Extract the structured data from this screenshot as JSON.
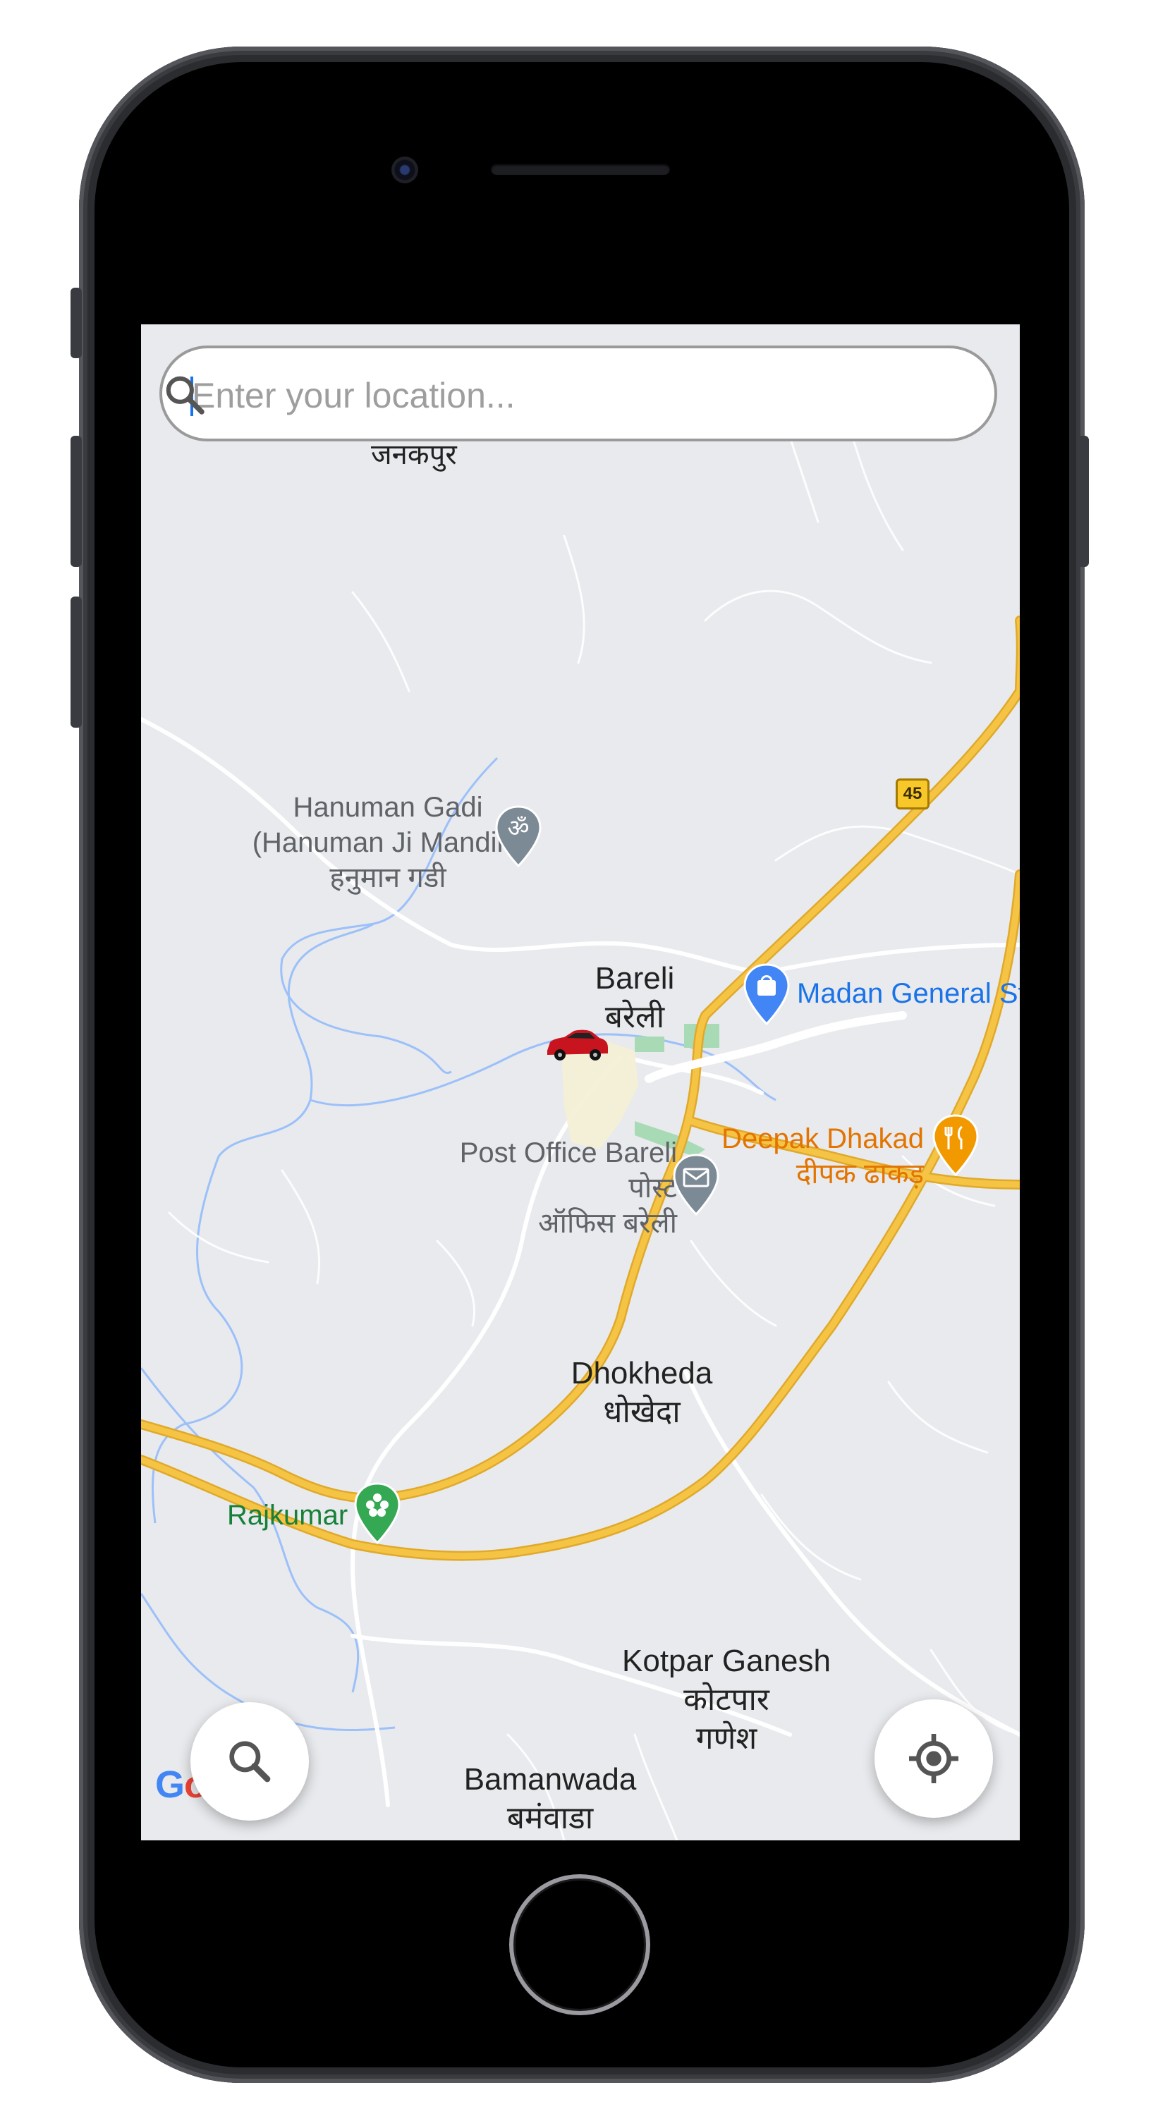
{
  "search": {
    "placeholder": "Enter your location..."
  },
  "map": {
    "labels": {
      "top_place_hi": "जनकपुर",
      "hanuman_en": "Hanuman Gadi",
      "hanuman_en2": "(Hanuman Ji Mandir )",
      "hanuman_hi": "हनुमान गडी",
      "bareli_en": "Bareli",
      "bareli_hi": "बरेली",
      "madan": "Madan General St",
      "post_office_en": "Post Office Bareli",
      "post_office_hi1": "पोस्ट",
      "post_office_hi2": "ऑफिस बरेली",
      "deepak_en": "Deepak Dhakad",
      "deepak_hi": "दीपक ढाकड़",
      "dhokheda_en": "Dhokheda",
      "dhokheda_hi": "धोखेदा",
      "rajkumar": "Rajkumar",
      "kotpar_en": "Kotpar Ganesh",
      "kotpar_hi1": "कोटपार",
      "kotpar_hi2": "गणेश",
      "bamanwada_en": "Bamanwada",
      "bamanwada_hi": "बमंवाडा",
      "highway_number": "45",
      "google_logo": "Goo"
    }
  },
  "icons": {
    "search": "search-icon",
    "om_temple": "om-icon",
    "shopping": "shopping-bag-icon",
    "restaurant": "fork-knife-icon",
    "mail": "mail-icon",
    "flower": "flower-icon",
    "car": "car-marker-icon",
    "locate": "my-location-icon"
  },
  "colors": {
    "map_bg": "#e8eaed",
    "highway": "#f6c445",
    "water": "#9cc0f9",
    "accent_blue": "#1a73e8",
    "poi_orange": "#e37400",
    "poi_green": "#188038",
    "poi_gray": "#5f6368"
  }
}
